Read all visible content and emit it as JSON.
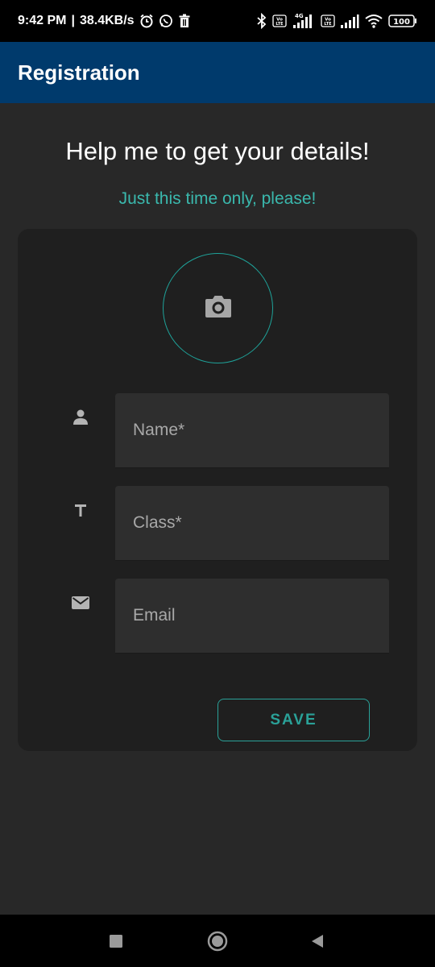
{
  "status_bar": {
    "time": "9:42 PM",
    "separator": "|",
    "net_speed": "38.4KB/s",
    "net_type": "4G",
    "volte_label": "Vo LTE",
    "battery": "100",
    "icons": [
      "alarm-icon",
      "whatsapp-icon",
      "trash-icon",
      "bluetooth-icon",
      "volte-icon",
      "signal-icon",
      "wifi-icon",
      "battery-icon"
    ]
  },
  "app_bar": {
    "title": "Registration"
  },
  "main": {
    "heading": "Help me to get your details!",
    "subheading": "Just this time only, please!"
  },
  "form": {
    "photo_icon": "camera-icon",
    "fields": [
      {
        "icon": "person-icon",
        "placeholder": "Name*"
      },
      {
        "icon": "text-icon",
        "placeholder": "Class*"
      },
      {
        "icon": "mail-icon",
        "placeholder": "Email"
      }
    ],
    "save_label": "SAVE"
  },
  "nav_bar": {
    "icons": [
      "recents-icon",
      "home-icon",
      "back-icon"
    ]
  },
  "colors": {
    "app_bar": "#003a6c",
    "background": "#282828",
    "card": "#1f1f1f",
    "field": "#2e2e2e",
    "accent": "#2aa198",
    "subheading": "#3ab8ad"
  }
}
